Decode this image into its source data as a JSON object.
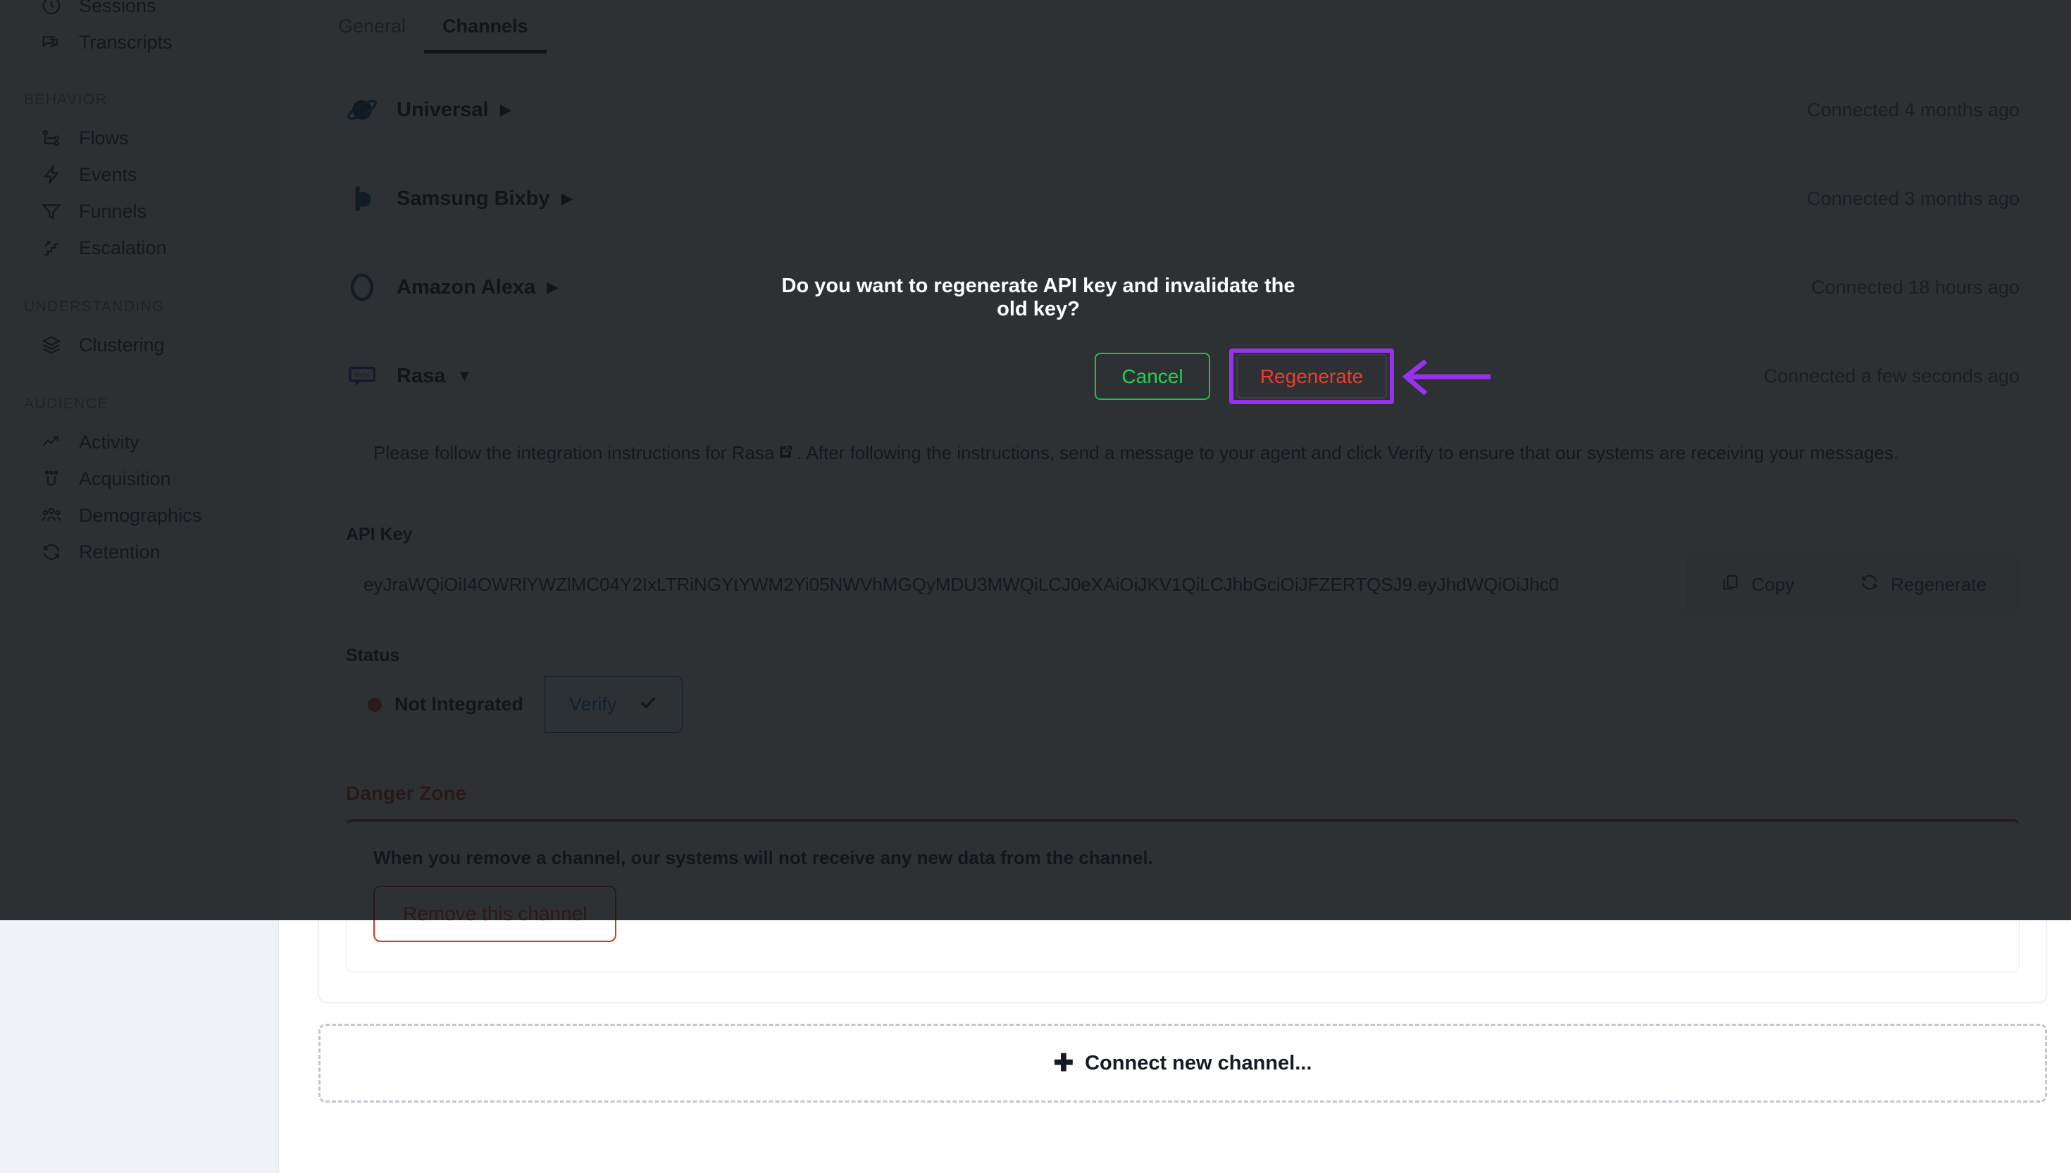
{
  "sidebar": {
    "items": [
      {
        "label": "Sessions",
        "icon": "sessions-icon",
        "group": null
      },
      {
        "label": "Transcripts",
        "icon": "transcripts-icon",
        "group": null
      }
    ],
    "groups": [
      {
        "title": "BEHAVIOR",
        "items": [
          {
            "label": "Flows",
            "icon": "flows-icon"
          },
          {
            "label": "Events",
            "icon": "events-icon"
          },
          {
            "label": "Funnels",
            "icon": "funnels-icon"
          },
          {
            "label": "Escalation",
            "icon": "escalation-icon"
          }
        ]
      },
      {
        "title": "UNDERSTANDING",
        "items": [
          {
            "label": "Clustering",
            "icon": "clustering-icon"
          }
        ]
      },
      {
        "title": "AUDIENCE",
        "items": [
          {
            "label": "Activity",
            "icon": "activity-icon"
          },
          {
            "label": "Acquisition",
            "icon": "acquisition-icon"
          },
          {
            "label": "Demographics",
            "icon": "demographics-icon"
          },
          {
            "label": "Retention",
            "icon": "retention-icon"
          }
        ]
      }
    ]
  },
  "tabs": [
    {
      "label": "General",
      "active": false
    },
    {
      "label": "Channels",
      "active": true
    }
  ],
  "channels": [
    {
      "name": "Universal",
      "logo": "universal-logo",
      "caret": "▶",
      "connected": "Connected 4 months ago",
      "expanded": false
    },
    {
      "name": "Samsung Bixby",
      "logo": "samsung-bixby-logo",
      "caret": "▶",
      "connected": "Connected 3 months ago",
      "expanded": false
    },
    {
      "name": "Amazon Alexa",
      "logo": "amazon-alexa-logo",
      "caret": "▶",
      "connected": "Connected 18 hours ago",
      "expanded": false
    },
    {
      "name": "Rasa",
      "logo": "rasa-logo",
      "caret": "▼",
      "connected": "Connected a few seconds ago",
      "expanded": true
    }
  ],
  "rasa_panel": {
    "instructions_pre": "Please follow the integration instructions for Rasa",
    "instructions_post": ". After following the instructions, send a message to your agent and click Verify to ensure that our systems are receiving your messages.",
    "external_link_icon": "external-link-icon",
    "api_key_label": "API Key",
    "api_key_value": "eyJraWQiOiI4OWRlYWZlMC04Y2IxLTRiNGYtYWM2Yi05NWVhMGQyMDU3MWQiLCJ0eXAiOiJKV1QiLCJhbGciOiJFZERTQSJ9.eyJhdWQiOiJhc0",
    "copy_label": "Copy",
    "copy_icon": "copy-icon",
    "regenerate_label": "Regenerate",
    "regenerate_icon": "refresh-icon",
    "status_label": "Status",
    "status_value": "Not Integrated",
    "status_color": "#e23b3b",
    "verify_label": "Verify",
    "verify_icon": "check-icon",
    "danger_title": "Danger Zone",
    "danger_text": "When you remove a channel, our systems will not receive any new data from the channel.",
    "remove_label": "Remove this channel"
  },
  "connect_new": {
    "label": "Connect new channel...",
    "plus_icon": "plus-icon"
  },
  "modal": {
    "question": "Do you want to regenerate API key and invalidate the old key?",
    "cancel_label": "Cancel",
    "cancel_color": "#22d257",
    "regenerate_label": "Regenerate",
    "regenerate_color": "#ef3b2d",
    "highlight_color": "#9333ea",
    "annotation_icon": "left-arrow-annotation"
  }
}
